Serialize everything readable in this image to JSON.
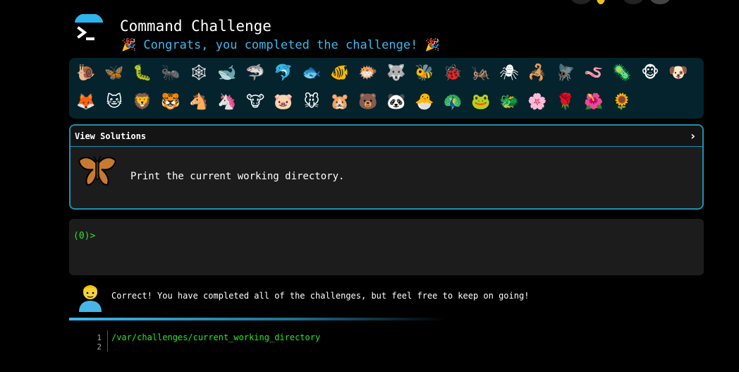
{
  "header": {
    "title": "Command Challenge",
    "subtitle": "🎉 Congrats, you completed the challenge! 🎉"
  },
  "emoji_panel": {
    "emojis": [
      "🐌",
      "🦋",
      "🐛",
      "🐜",
      "🕸",
      "🐋",
      "🦈",
      "🐬",
      "🐟",
      "🐠",
      "🐡",
      "🐺",
      "🐝",
      "🐞",
      "🦗",
      "🕷",
      "🦂",
      "🪰",
      "🪱",
      "🦠",
      "🐵",
      "🐶",
      "🦊",
      "🐱",
      "🦁",
      "🐯",
      "🐴",
      "🦄",
      "🐮",
      "🐷",
      "🐭",
      "🐹",
      "🐻",
      "🐼",
      "🐣",
      "🦚",
      "🐸",
      "🐲",
      "🌸",
      "🌹",
      "🌺",
      "🌻"
    ]
  },
  "solutions": {
    "label": "View Solutions",
    "chevron": "›",
    "task": "Print the current working directory."
  },
  "terminal": {
    "prompt": "(0)>"
  },
  "feedback": {
    "message": "Correct! You have completed all of the challenges, but feel free to keep on going!"
  },
  "output": {
    "line_numbers": [
      "1",
      "2"
    ],
    "lines": [
      "/var/challenges/current_working_directory"
    ]
  }
}
